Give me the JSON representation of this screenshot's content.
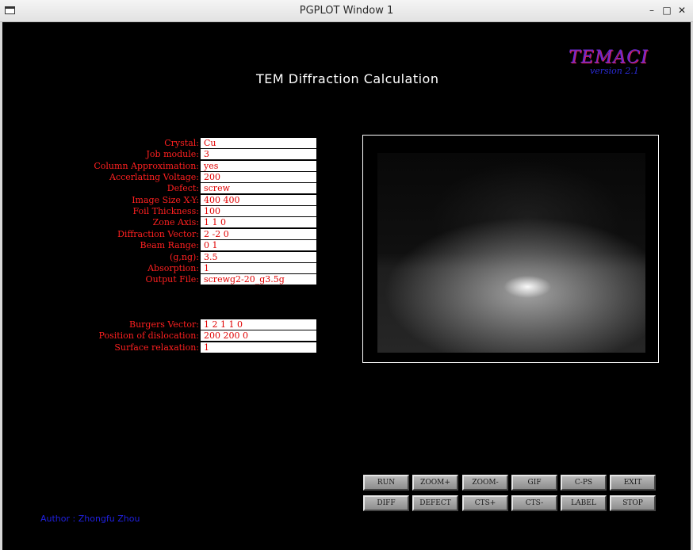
{
  "window": {
    "title": "PGPLOT Window 1",
    "minimize": "–",
    "maximize": "□",
    "close": "✕"
  },
  "brand": {
    "name": "TEMACI",
    "version": "version 2.1"
  },
  "heading": "TEM Diffraction Calculation",
  "params": [
    {
      "label": "Crystal:",
      "value": "Cu"
    },
    {
      "label": "Job module:",
      "value": "3"
    },
    {
      "label": "Column Approximation:",
      "value": "yes"
    },
    {
      "label": "Accerlating Voltage:",
      "value": "200"
    },
    {
      "label": "Defect:",
      "value": "screw"
    },
    {
      "label": "Image Size X-Y:",
      "value": "400 400"
    },
    {
      "label": "Foil Thickness:",
      "value": "100"
    },
    {
      "label": "Zone Axis:",
      "value": "1 1 0"
    },
    {
      "label": "Diffraction Vector:",
      "value": "2 -2 0"
    },
    {
      "label": "Beam Range:",
      "value": "0 1"
    },
    {
      "label": "(g,ng):",
      "value": "3.5"
    },
    {
      "label": "Absorption:",
      "value": "1"
    },
    {
      "label": "Output File:",
      "value": "screwg2-20_g3.5g"
    }
  ],
  "dislocation": [
    {
      "label": "Burgers Vector:",
      "value": "1 2 1 1 0"
    },
    {
      "label": "Position of dislocation:",
      "value": "200 200 0"
    },
    {
      "label": "Surface relaxation:",
      "value": "1"
    }
  ],
  "buttons_row1": [
    "RUN",
    "ZOOM+",
    "ZOOM-",
    "GIF",
    "C-PS",
    "EXIT"
  ],
  "buttons_row2": [
    "DIFF",
    "DEFECT",
    "CTS+",
    "CTS-",
    "LABEL",
    "STOP"
  ],
  "author": "Author : Zhongfu Zhou"
}
